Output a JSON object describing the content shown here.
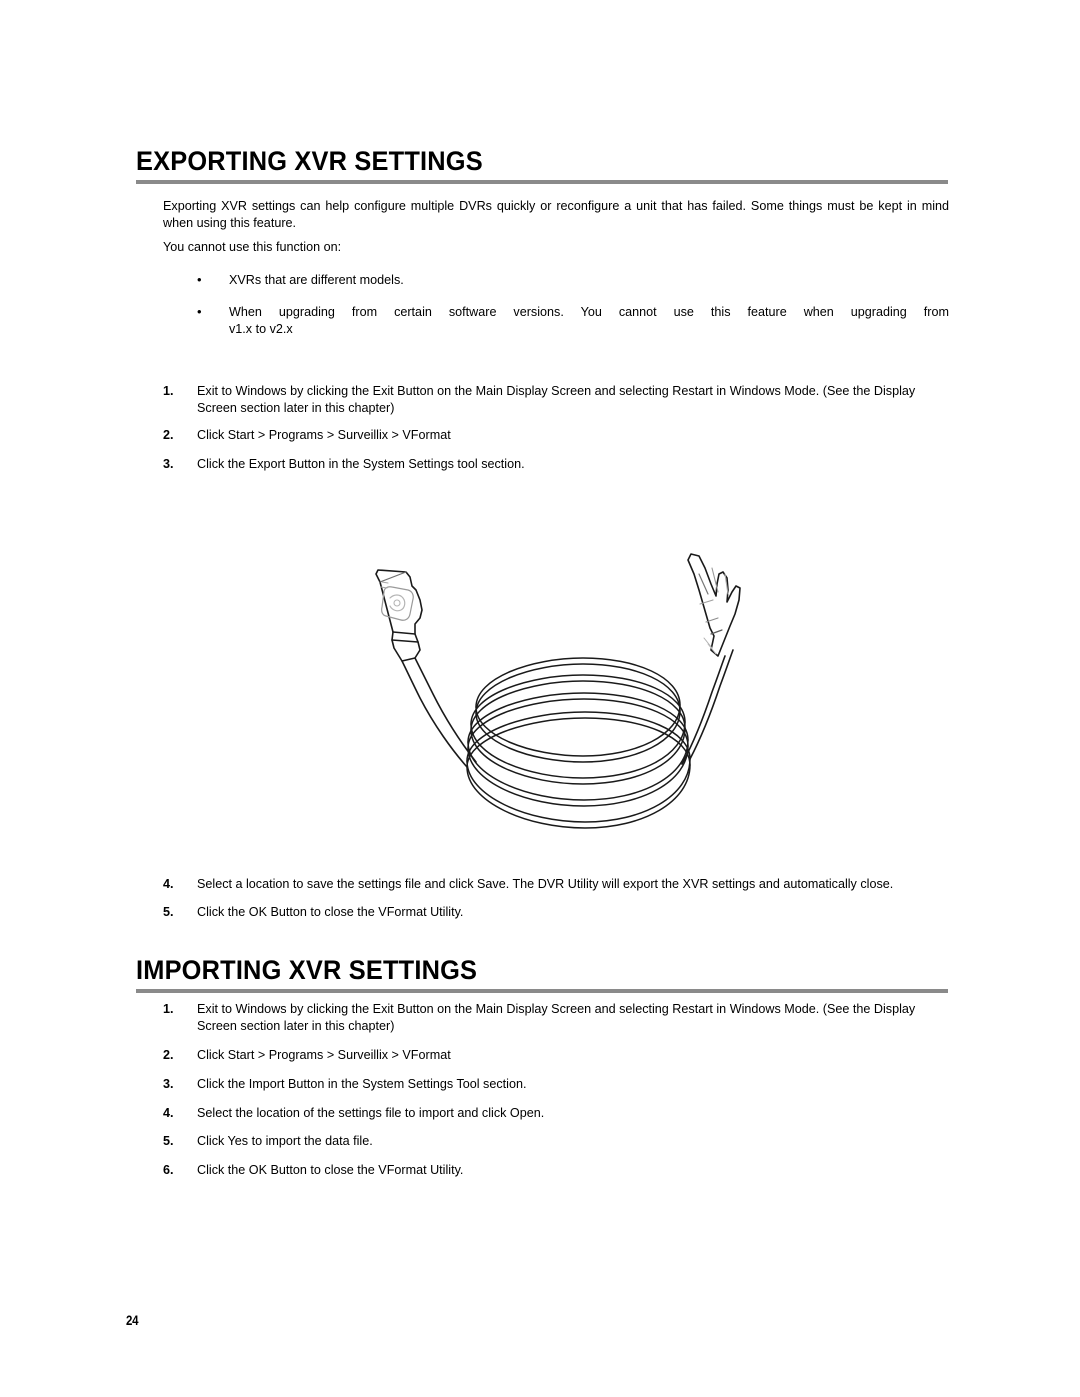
{
  "document": {
    "page_number": "24",
    "rule_color": "#8a8a8a"
  },
  "sections": [
    {
      "heading": "EXPORTING XVR SETTINGS",
      "intro_paragraph": "Exporting XVR settings can help configure multiple DVRs quickly or reconfigure a unit that has failed. Some things must be kept in mind when using this feature.",
      "lead_in": "You cannot use this function on:",
      "bullets": [
        "XVRs that are different models.",
        "When upgrading from certain software versions. You cannot use this feature when upgrading from",
        "v1.x to v2.x"
      ],
      "steps_before_figure": [
        {
          "number": "1.",
          "text": "Exit to Windows by clicking the Exit Button on the Main Display Screen and selecting Restart in Windows Mode. (See the Display Screen section later in this chapter)"
        },
        {
          "number": "2.",
          "text": "Click Start > Programs > Surveillix > VFormat"
        },
        {
          "number": "3.",
          "text": "Click the Export Button in the System Settings tool section."
        }
      ],
      "figure": {
        "name": "usb-cable-illustration",
        "description": "Line drawing of a coiled flat cable with a USB type-A connector on the left and a flat connector on the right"
      },
      "steps_after_figure": [
        {
          "number": "4.",
          "text": "Select a location to save the settings file and click Save. The DVR Utility will export the XVR settings and automatically close."
        },
        {
          "number": "5.",
          "text": "Click the OK Button to close the VFormat Utility."
        }
      ]
    },
    {
      "heading": "IMPORTING XVR SETTINGS",
      "steps": [
        {
          "number": "1.",
          "text": "Exit to Windows by clicking the Exit Button on the Main Display Screen and selecting Restart in Windows Mode. (See the Display Screen section later in this chapter)"
        },
        {
          "number": "2.",
          "text": "Click Start > Programs > Surveillix > VFormat"
        },
        {
          "number": "3.",
          "text": "Click the Import Button in the System Settings Tool section."
        },
        {
          "number": "4.",
          "text": "Select the location of the settings file to import and click Open."
        },
        {
          "number": "5.",
          "text": "Click Yes to import the data file."
        },
        {
          "number": "6.",
          "text": "Click the OK Button to close the VFormat Utility."
        }
      ]
    }
  ],
  "bullet_glyph": "•"
}
